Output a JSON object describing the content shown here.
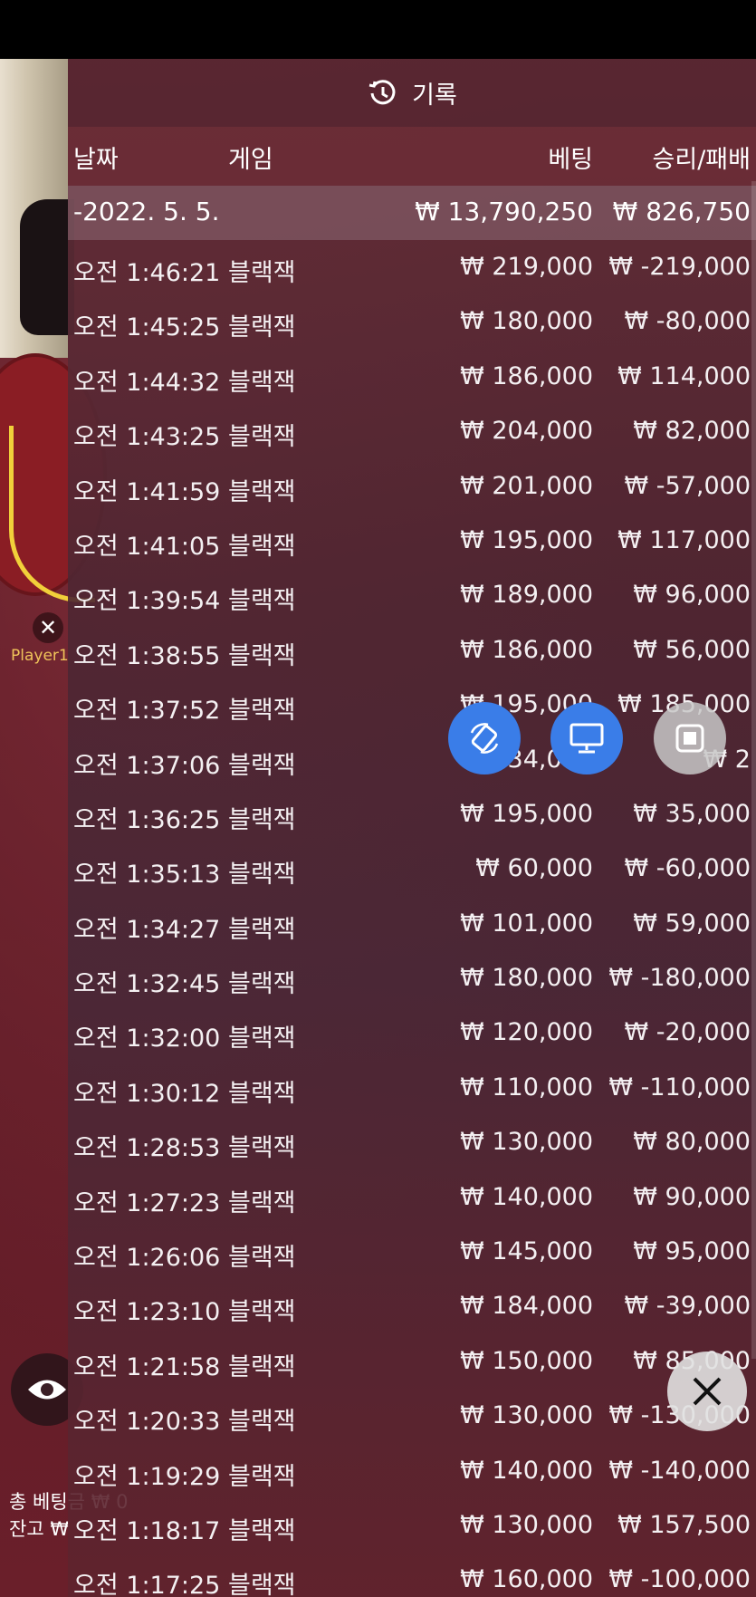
{
  "game": {
    "player_label": "Player1",
    "total_bet_label": "총 베팅금 ₩ 0",
    "balance_label": "잔고 ₩"
  },
  "history": {
    "title": "기록",
    "columns": {
      "date": "날짜",
      "game": "게임",
      "bet": "베팅",
      "result": "승리/패배"
    },
    "date_group": {
      "date": "-2022. 5. 5.",
      "total_bet": "₩ 13,790,250",
      "total_result": "₩ 826,750"
    },
    "rows": [
      {
        "time": "오전 1:46:21",
        "game": "블랙잭",
        "bet": "₩ 219,000",
        "result": "₩ -219,000"
      },
      {
        "time": "오전 1:45:25",
        "game": "블랙잭",
        "bet": "₩ 180,000",
        "result": "₩ -80,000"
      },
      {
        "time": "오전 1:44:32",
        "game": "블랙잭",
        "bet": "₩ 186,000",
        "result": "₩ 114,000"
      },
      {
        "time": "오전 1:43:25",
        "game": "블랙잭",
        "bet": "₩ 204,000",
        "result": "₩ 82,000"
      },
      {
        "time": "오전 1:41:59",
        "game": "블랙잭",
        "bet": "₩ 201,000",
        "result": "₩ -57,000"
      },
      {
        "time": "오전 1:41:05",
        "game": "블랙잭",
        "bet": "₩ 195,000",
        "result": "₩ 117,000"
      },
      {
        "time": "오전 1:39:54",
        "game": "블랙잭",
        "bet": "₩ 189,000",
        "result": "₩ 96,000"
      },
      {
        "time": "오전 1:38:55",
        "game": "블랙잭",
        "bet": "₩ 186,000",
        "result": "₩ 56,000"
      },
      {
        "time": "오전 1:37:52",
        "game": "블랙잭",
        "bet": "₩ 195,000",
        "result": "₩ 185,000"
      },
      {
        "time": "오전 1:37:06",
        "game": "블랙잭",
        "bet": "₩ 234,000",
        "result": "₩ 2"
      },
      {
        "time": "오전 1:36:25",
        "game": "블랙잭",
        "bet": "₩ 195,000",
        "result": "₩ 35,000"
      },
      {
        "time": "오전 1:35:13",
        "game": "블랙잭",
        "bet": "₩ 60,000",
        "result": "₩ -60,000"
      },
      {
        "time": "오전 1:34:27",
        "game": "블랙잭",
        "bet": "₩ 101,000",
        "result": "₩ 59,000"
      },
      {
        "time": "오전 1:32:45",
        "game": "블랙잭",
        "bet": "₩ 180,000",
        "result": "₩ -180,000"
      },
      {
        "time": "오전 1:32:00",
        "game": "블랙잭",
        "bet": "₩ 120,000",
        "result": "₩ -20,000"
      },
      {
        "time": "오전 1:30:12",
        "game": "블랙잭",
        "bet": "₩ 110,000",
        "result": "₩ -110,000"
      },
      {
        "time": "오전 1:28:53",
        "game": "블랙잭",
        "bet": "₩ 130,000",
        "result": "₩ 80,000"
      },
      {
        "time": "오전 1:27:23",
        "game": "블랙잭",
        "bet": "₩ 140,000",
        "result": "₩ 90,000"
      },
      {
        "time": "오전 1:26:06",
        "game": "블랙잭",
        "bet": "₩ 145,000",
        "result": "₩ 95,000"
      },
      {
        "time": "오전 1:23:10",
        "game": "블랙잭",
        "bet": "₩ 184,000",
        "result": "₩ -39,000"
      },
      {
        "time": "오전 1:21:58",
        "game": "블랙잭",
        "bet": "₩ 150,000",
        "result": "₩ 85,000"
      },
      {
        "time": "오전 1:20:33",
        "game": "블랙잭",
        "bet": "₩ 130,000",
        "result": "₩ -130,000"
      },
      {
        "time": "오전 1:19:29",
        "game": "블랙잭",
        "bet": "₩ 140,000",
        "result": "₩ -140,000"
      },
      {
        "time": "오전 1:18:17",
        "game": "블랙잭",
        "bet": "₩ 130,000",
        "result": "₩ 157,500"
      },
      {
        "time": "오전 1:17:25",
        "game": "블랙잭",
        "bet": "₩ 160,000",
        "result": "₩ -100,000"
      }
    ]
  },
  "icons": {
    "history": "history-icon",
    "rotate": "rotate-icon",
    "screen": "monitor-icon",
    "stop": "stop-icon",
    "close": "close-icon",
    "eye": "eye-icon"
  },
  "colors": {
    "accent_blue": "#3a7de8",
    "gold": "#f1d03a"
  }
}
